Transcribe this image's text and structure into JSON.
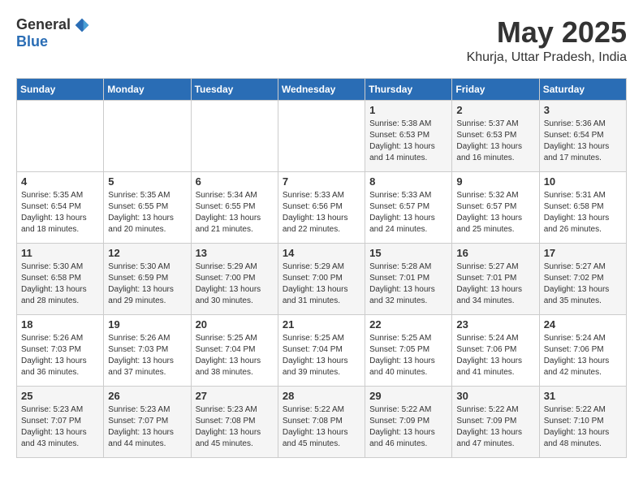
{
  "header": {
    "logo_general": "General",
    "logo_blue": "Blue",
    "month_title": "May 2025",
    "location": "Khurja, Uttar Pradesh, India"
  },
  "calendar": {
    "days_of_week": [
      "Sunday",
      "Monday",
      "Tuesday",
      "Wednesday",
      "Thursday",
      "Friday",
      "Saturday"
    ],
    "weeks": [
      [
        {
          "day": "",
          "content": ""
        },
        {
          "day": "",
          "content": ""
        },
        {
          "day": "",
          "content": ""
        },
        {
          "day": "",
          "content": ""
        },
        {
          "day": "1",
          "content": "Sunrise: 5:38 AM\nSunset: 6:53 PM\nDaylight: 13 hours\nand 14 minutes."
        },
        {
          "day": "2",
          "content": "Sunrise: 5:37 AM\nSunset: 6:53 PM\nDaylight: 13 hours\nand 16 minutes."
        },
        {
          "day": "3",
          "content": "Sunrise: 5:36 AM\nSunset: 6:54 PM\nDaylight: 13 hours\nand 17 minutes."
        }
      ],
      [
        {
          "day": "4",
          "content": "Sunrise: 5:35 AM\nSunset: 6:54 PM\nDaylight: 13 hours\nand 18 minutes."
        },
        {
          "day": "5",
          "content": "Sunrise: 5:35 AM\nSunset: 6:55 PM\nDaylight: 13 hours\nand 20 minutes."
        },
        {
          "day": "6",
          "content": "Sunrise: 5:34 AM\nSunset: 6:55 PM\nDaylight: 13 hours\nand 21 minutes."
        },
        {
          "day": "7",
          "content": "Sunrise: 5:33 AM\nSunset: 6:56 PM\nDaylight: 13 hours\nand 22 minutes."
        },
        {
          "day": "8",
          "content": "Sunrise: 5:33 AM\nSunset: 6:57 PM\nDaylight: 13 hours\nand 24 minutes."
        },
        {
          "day": "9",
          "content": "Sunrise: 5:32 AM\nSunset: 6:57 PM\nDaylight: 13 hours\nand 25 minutes."
        },
        {
          "day": "10",
          "content": "Sunrise: 5:31 AM\nSunset: 6:58 PM\nDaylight: 13 hours\nand 26 minutes."
        }
      ],
      [
        {
          "day": "11",
          "content": "Sunrise: 5:30 AM\nSunset: 6:58 PM\nDaylight: 13 hours\nand 28 minutes."
        },
        {
          "day": "12",
          "content": "Sunrise: 5:30 AM\nSunset: 6:59 PM\nDaylight: 13 hours\nand 29 minutes."
        },
        {
          "day": "13",
          "content": "Sunrise: 5:29 AM\nSunset: 7:00 PM\nDaylight: 13 hours\nand 30 minutes."
        },
        {
          "day": "14",
          "content": "Sunrise: 5:29 AM\nSunset: 7:00 PM\nDaylight: 13 hours\nand 31 minutes."
        },
        {
          "day": "15",
          "content": "Sunrise: 5:28 AM\nSunset: 7:01 PM\nDaylight: 13 hours\nand 32 minutes."
        },
        {
          "day": "16",
          "content": "Sunrise: 5:27 AM\nSunset: 7:01 PM\nDaylight: 13 hours\nand 34 minutes."
        },
        {
          "day": "17",
          "content": "Sunrise: 5:27 AM\nSunset: 7:02 PM\nDaylight: 13 hours\nand 35 minutes."
        }
      ],
      [
        {
          "day": "18",
          "content": "Sunrise: 5:26 AM\nSunset: 7:03 PM\nDaylight: 13 hours\nand 36 minutes."
        },
        {
          "day": "19",
          "content": "Sunrise: 5:26 AM\nSunset: 7:03 PM\nDaylight: 13 hours\nand 37 minutes."
        },
        {
          "day": "20",
          "content": "Sunrise: 5:25 AM\nSunset: 7:04 PM\nDaylight: 13 hours\nand 38 minutes."
        },
        {
          "day": "21",
          "content": "Sunrise: 5:25 AM\nSunset: 7:04 PM\nDaylight: 13 hours\nand 39 minutes."
        },
        {
          "day": "22",
          "content": "Sunrise: 5:25 AM\nSunset: 7:05 PM\nDaylight: 13 hours\nand 40 minutes."
        },
        {
          "day": "23",
          "content": "Sunrise: 5:24 AM\nSunset: 7:06 PM\nDaylight: 13 hours\nand 41 minutes."
        },
        {
          "day": "24",
          "content": "Sunrise: 5:24 AM\nSunset: 7:06 PM\nDaylight: 13 hours\nand 42 minutes."
        }
      ],
      [
        {
          "day": "25",
          "content": "Sunrise: 5:23 AM\nSunset: 7:07 PM\nDaylight: 13 hours\nand 43 minutes."
        },
        {
          "day": "26",
          "content": "Sunrise: 5:23 AM\nSunset: 7:07 PM\nDaylight: 13 hours\nand 44 minutes."
        },
        {
          "day": "27",
          "content": "Sunrise: 5:23 AM\nSunset: 7:08 PM\nDaylight: 13 hours\nand 45 minutes."
        },
        {
          "day": "28",
          "content": "Sunrise: 5:22 AM\nSunset: 7:08 PM\nDaylight: 13 hours\nand 45 minutes."
        },
        {
          "day": "29",
          "content": "Sunrise: 5:22 AM\nSunset: 7:09 PM\nDaylight: 13 hours\nand 46 minutes."
        },
        {
          "day": "30",
          "content": "Sunrise: 5:22 AM\nSunset: 7:09 PM\nDaylight: 13 hours\nand 47 minutes."
        },
        {
          "day": "31",
          "content": "Sunrise: 5:22 AM\nSunset: 7:10 PM\nDaylight: 13 hours\nand 48 minutes."
        }
      ]
    ]
  }
}
